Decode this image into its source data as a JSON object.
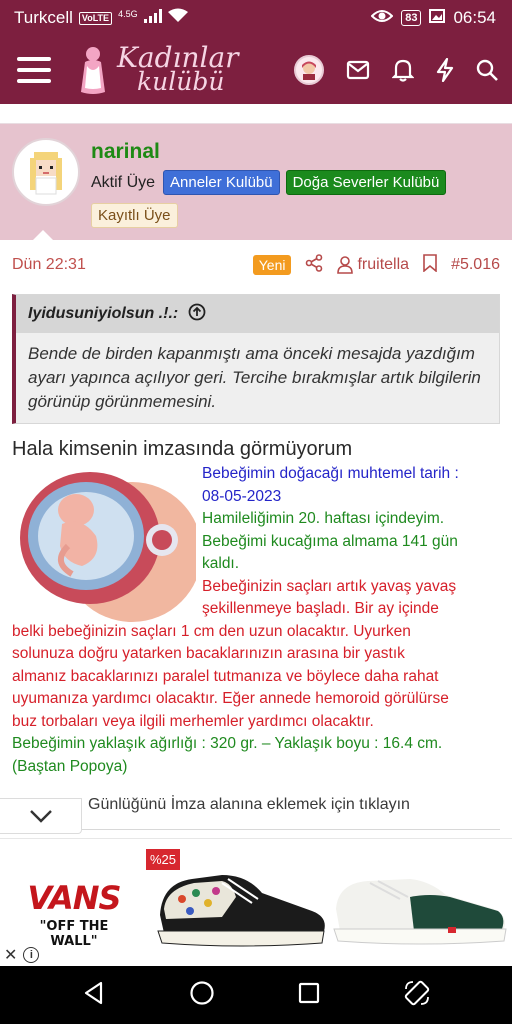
{
  "status_bar": {
    "carrier": "Turkcell",
    "volte": "VoLTE",
    "network": "4.5G",
    "battery": "83",
    "time": "06:54"
  },
  "app_header": {
    "logo_line1": "Kadınlar",
    "logo_line2": "kulübü",
    "brand_color": "#7d1f3f"
  },
  "user": {
    "username": "narinal",
    "title": "Aktif Üye",
    "badges": [
      "Anneler Kulübü",
      "Doğa Severler Kulübü"
    ],
    "registered_badge": "Kayıtlı Üye"
  },
  "post_meta": {
    "time": "Dün 22:31",
    "new_label": "Yeni",
    "author": "fruitella",
    "post_number": "#5.016"
  },
  "quote": {
    "author": "Iyidusuniyiolsun .!.:",
    "text": "Bende de birden kapanmıştı ama önceki mesajda yazdığım ayarı yapınca açılıyor geri. Tercihe bırakmışlar artık bilgilerin görünüp görünmemesini."
  },
  "post": {
    "title": "Hala kimsenin imzasında görmüyorum",
    "sig_lines": [
      {
        "text": "Bebeğimin doğacağı muhtemel tarih :",
        "color": "blue",
        "indent": true
      },
      {
        "text": "08-05-2023",
        "color": "blue",
        "indent": true
      },
      {
        "text": "Hamileliğimin 20. haftası içindeyim.",
        "color": "green",
        "indent": true
      },
      {
        "text": "Bebeğimi kucağıma almama 141 gün",
        "color": "green",
        "indent": true
      },
      {
        "text": "kaldı.",
        "color": "green",
        "indent": true
      },
      {
        "text": "Bebeğinizin saçları artık yavaş yavaş",
        "color": "red",
        "indent": true
      },
      {
        "text": "şekillenmeye başladı. Bir ay içinde",
        "color": "red",
        "indent": true
      },
      {
        "text": "belki bebeğinizin saçları 1 cm den uzun olacaktır. Uyurken",
        "color": "red",
        "indent": false
      },
      {
        "text": "solunuza doğru yatarken bacaklarınızın arasına bir yastık",
        "color": "red",
        "indent": false
      },
      {
        "text": "almanız bacaklarınızı paralel tutmanıza ve böylece daha rahat",
        "color": "red",
        "indent": false
      },
      {
        "text": "uyumanıza yardımcı olacaktır. Eğer annede hemoroid görülürse",
        "color": "red",
        "indent": false
      },
      {
        "text": "buz torbaları veya ilgili merhemler yardımcı olacaktır.",
        "color": "red",
        "indent": false
      },
      {
        "text": "Bebeğimin yaklaşık ağırlığı : 320 gr. – Yaklaşık boyu : 16.4 cm.",
        "color": "green",
        "indent": false
      },
      {
        "text": "(Baştan Popoya)",
        "color": "green",
        "indent": false
      }
    ],
    "sig_link": "Günlüğünü İmza alanına eklemek için tıklayın"
  },
  "ad": {
    "brand": "VANS",
    "tagline": "\"OFF THE WALL\"",
    "discount": "%25"
  }
}
